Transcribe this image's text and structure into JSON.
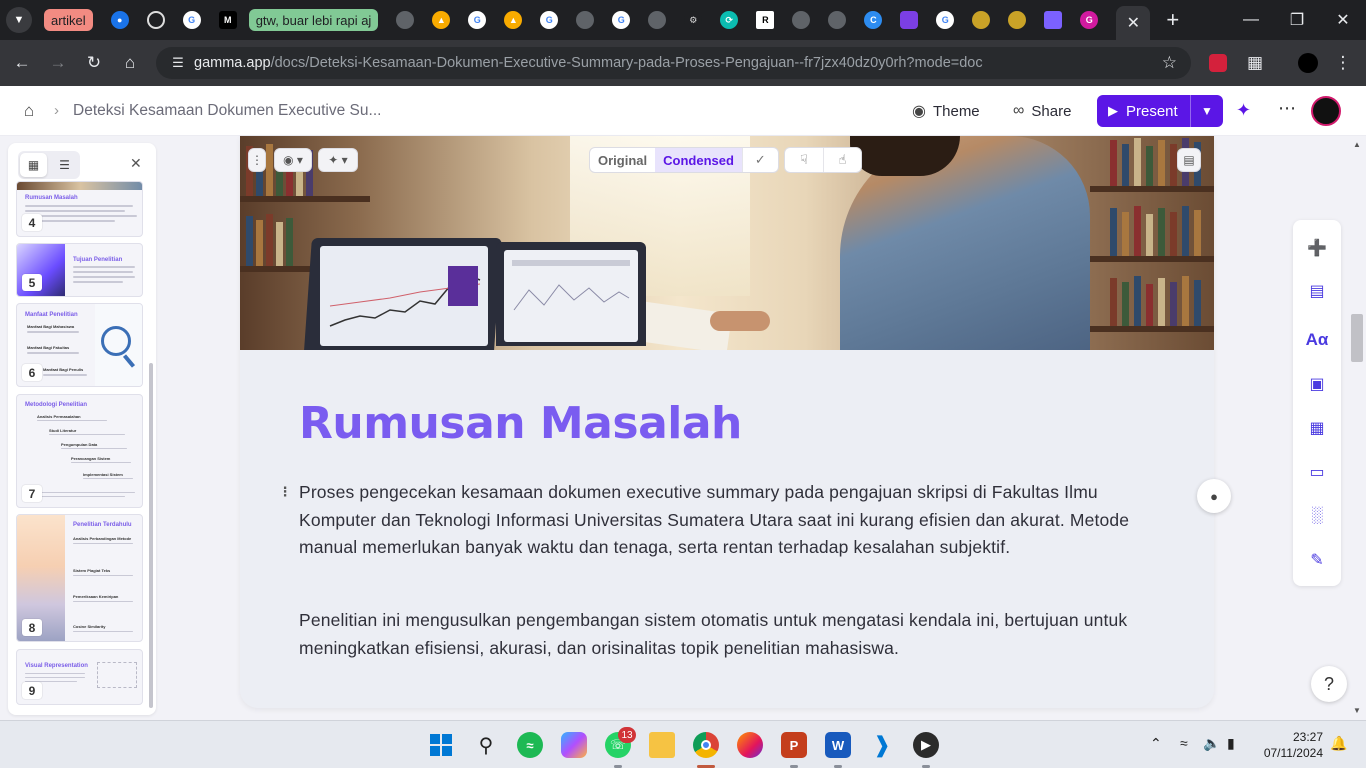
{
  "browser": {
    "tab_groups": [
      "artikel",
      "gtw, buar lebi rapi aj"
    ],
    "url_host": "gamma.app",
    "url_path": "/docs/Deteksi-Kesamaan-Dokumen-Executive-Summary-pada-Proses-Pengajuan--fr7jzx40dz0y0rh?mode=doc",
    "tab_icons": [
      "shield-pin-icon",
      "openai-icon",
      "google-icon",
      "medium-icon",
      "chromium-icon",
      "drive-triad-icon",
      "google-icon",
      "drive-triad-icon",
      "google-icon",
      "globe-icon",
      "google-icon",
      "globe-icon",
      "robot-icon",
      "refresh-icon",
      "researchgate-icon",
      "globe-icon",
      "globe-icon",
      "canva-icon",
      "app-icon",
      "google-icon",
      "university-icon",
      "university-icon",
      "stack-icon",
      "gamma-icon"
    ]
  },
  "app": {
    "breadcrumb_title": "Deteksi Kesamaan Dokumen Executive Su...",
    "theme_label": "Theme",
    "share_label": "Share",
    "present_label": "Present"
  },
  "sidebar": {
    "thumbnails": [
      {
        "number": "4",
        "title": "Rumusan Masalah"
      },
      {
        "number": "5",
        "title": "Tujuan Penelitian"
      },
      {
        "number": "6",
        "title": "Manfaat Penelitian",
        "subs": [
          "Manfaat Bagi Mahasiswa",
          "Manfaat Bagi Fakultas",
          "Manfaat Bagi Penulis"
        ]
      },
      {
        "number": "7",
        "title": "Metodologi Penelitian",
        "subs": [
          "Analisis Permasalahan",
          "Studi Literatur",
          "Pengumpulan Data",
          "Perancangan Sistem",
          "Implementasi Sistem"
        ]
      },
      {
        "number": "8",
        "title": "Penelitian Terdahulu",
        "subs": [
          "Analisis Perbandingan Metode",
          "Sistem Plagiat Teks",
          "Pemeriksaan Kemiripan",
          "Cosine Similarity"
        ]
      },
      {
        "number": "9",
        "title": "Visual Representation"
      }
    ]
  },
  "card": {
    "toggle_original": "Original",
    "toggle_condensed": "Condensed",
    "heading": "Rumusan Masalah",
    "paragraph_1": "Proses pengecekan kesamaan dokumen executive summary pada pengajuan skripsi di Fakultas Ilmu Komputer dan Teknologi Informasi Universitas Sumatera Utara saat ini kurang efisien dan akurat. Metode manual memerlukan banyak waktu dan tenaga, serta rentan terhadap kesalahan subjektif.",
    "paragraph_2": "Penelitian ini mengusulkan pengembangan sistem otomatis untuk mengatasi kendala ini, bertujuan untuk meningkatkan efisiensi, akurasi, dan orisinalitas topik penelitian mahasiswa."
  },
  "right_tools": [
    "add-card-icon",
    "layout-icon",
    "text-style-icon",
    "image-icon",
    "video-icon",
    "embed-icon",
    "chart-icon",
    "edit-icon"
  ],
  "taskbar": {
    "whatsapp_badge": "13",
    "time": "23:27",
    "date": "07/11/2024"
  },
  "colors": {
    "accent": "#5b16e6",
    "heading": "#7a5cf0",
    "browser_dark": "#1f2023"
  }
}
